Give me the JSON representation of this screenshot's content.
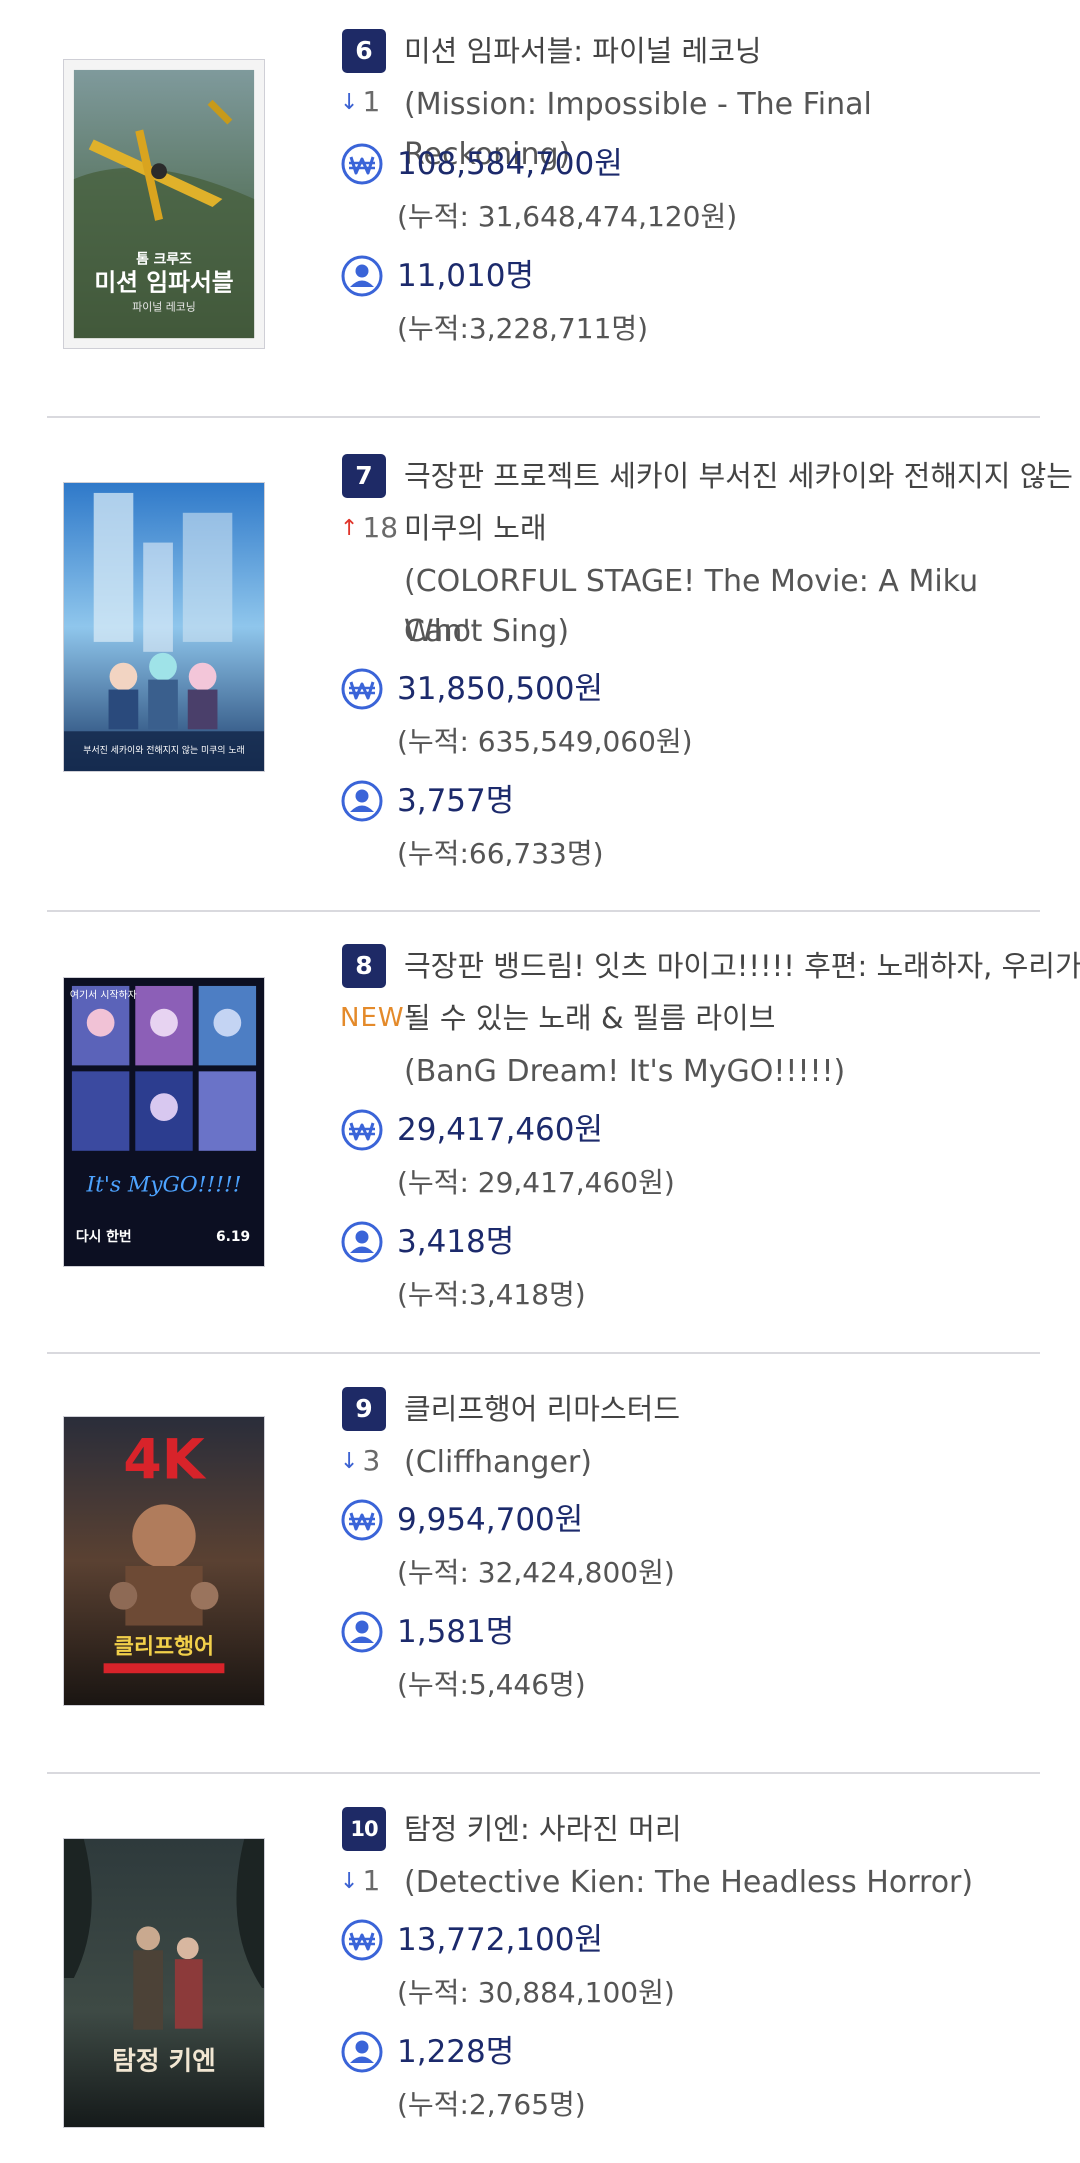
{
  "icons": {
    "revenue": "won-currency-icon",
    "audience": "person-icon"
  },
  "colors": {
    "badge": "#1e2a66",
    "stat_text": "#1c2a6c",
    "down_arrow": "#3c62d2",
    "up_arrow": "#e0352b",
    "new_label": "#e48a2a",
    "icon_blue": "#3a64d8"
  },
  "movies": [
    {
      "rank": "6",
      "change": {
        "direction": "down",
        "amount": "1"
      },
      "title_ko": "미션 임파서블: 파이널 레코닝",
      "title_en": "(Mission: Impossible - The Final Reckoning)",
      "revenue": "108,584,700원",
      "revenue_total": "(누적: 31,648,474,120원)",
      "audience": "11,010명",
      "audience_total": "(누적:3,228,711명)",
      "poster_text": [
        "톰 크루즈",
        "미션 임파서블",
        "파이널 레코닝"
      ]
    },
    {
      "rank": "7",
      "change": {
        "direction": "up",
        "amount": "18"
      },
      "title_ko": "극장판 프로젝트 세카이 부서진 세카이와 전해지지 않는",
      "title_ko_line2": "미쿠의 노래",
      "title_en": "(COLORFUL STAGE! The Movie: A Miku Who",
      "title_en_line2": "Can't Sing)",
      "revenue": "31,850,500원",
      "revenue_total": "(누적: 635,549,060원)",
      "audience": "3,757명",
      "audience_total": "(누적:66,733명)",
      "poster_text": [
        "부서진 세카이와 전해지지 않는 미쿠의 노래"
      ]
    },
    {
      "rank": "8",
      "change": {
        "direction": "new",
        "label": "NEW"
      },
      "title_ko": "극장판 뱅드림! 잇츠 마이고!!!!! 후편: 노래하자, 우리가",
      "title_ko_line2": "될 수 있는 노래 & 필름 라이브",
      "title_en": "(BanG Dream! It's MyGO!!!!!)",
      "revenue": "29,417,460원",
      "revenue_total": "(누적: 29,417,460원)",
      "audience": "3,418명",
      "audience_total": "(누적:3,418명)",
      "poster_text": [
        "여기서 시작하자",
        "It's MyGO!!!!!",
        "다시 한번",
        "6.19"
      ]
    },
    {
      "rank": "9",
      "change": {
        "direction": "down",
        "amount": "3"
      },
      "title_ko": "클리프행어 리마스터드",
      "title_en": "(Cliffhanger)",
      "revenue": "9,954,700원",
      "revenue_total": "(누적: 32,424,800원)",
      "audience": "1,581명",
      "audience_total": "(누적:5,446명)",
      "poster_text": [
        "4K",
        "클리프행어"
      ]
    },
    {
      "rank": "10",
      "change": {
        "direction": "down",
        "amount": "1"
      },
      "title_ko": "탐정 키엔: 사라진 머리",
      "title_en": "(Detective Kien: The Headless Horror)",
      "revenue": "13,772,100원",
      "revenue_total": "(누적: 30,884,100원)",
      "audience": "1,228명",
      "audience_total": "(누적:2,765명)",
      "poster_text": [
        "탐정 키엔"
      ]
    }
  ]
}
